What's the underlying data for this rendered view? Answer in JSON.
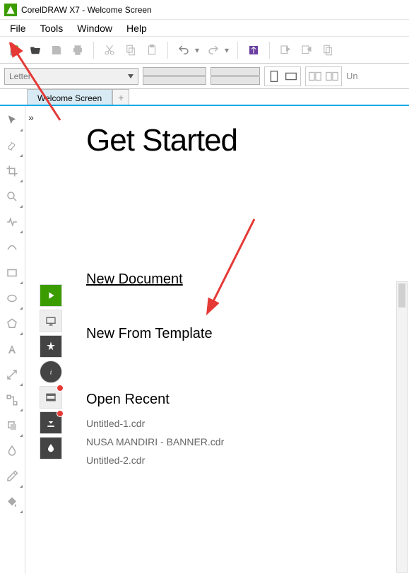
{
  "app": {
    "title": "CorelDRAW X7 - Welcome Screen"
  },
  "menu": {
    "file": "File",
    "tools": "Tools",
    "window": "Window",
    "help": "Help"
  },
  "propbar": {
    "pagesize": "Letter",
    "unit_label": "Un"
  },
  "tabs": {
    "welcome": "Welcome Screen"
  },
  "welcome": {
    "heading": "Get Started",
    "new_doc": "New Document",
    "new_template": "New From Template",
    "open_recent": "Open Recent",
    "recents": [
      "Untitled-1.cdr",
      "NUSA MANDIRI - BANNER.cdr",
      "Untitled-2.cdr"
    ]
  }
}
